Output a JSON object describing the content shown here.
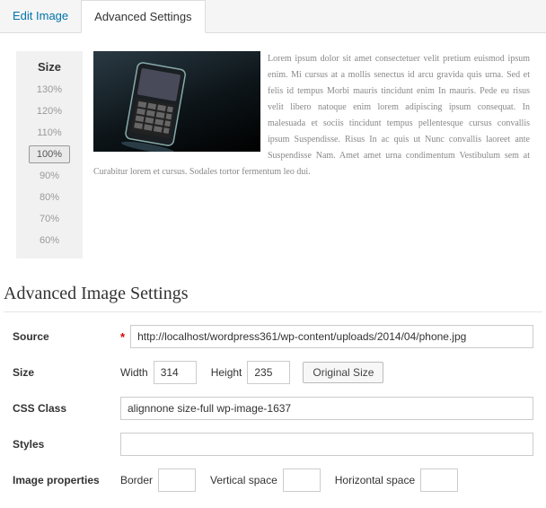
{
  "tabs": {
    "edit": "Edit Image",
    "advanced": "Advanced Settings"
  },
  "size_panel": {
    "title": "Size",
    "selected": "100%",
    "options": [
      "130%",
      "120%",
      "110%",
      "100%",
      "90%",
      "80%",
      "70%",
      "60%"
    ]
  },
  "lorem": "Lorem ipsum dolor sit amet consectetuer velit pretium euismod ipsum enim. Mi cursus at a mollis senectus id arcu gravida quis urna. Sed et felis id tempus Morbi mauris tincidunt enim In mauris. Pede eu risus velit libero natoque enim lorem adipiscing ipsum consequat. In malesuada et sociis tincidunt tempus pellentesque cursus convallis ipsum Suspendisse. Risus In ac quis ut Nunc convallis laoreet ante Suspendisse Nam. Amet amet urna condimentum Vestibulum sem at Curabitur lorem et cursus. Sodales tortor fermentum leo dui.",
  "section_title": "Advanced Image Settings",
  "form": {
    "source": {
      "label": "Source",
      "value": "http://localhost/wordpress361/wp-content/uploads/2014/04/phone.jpg"
    },
    "size": {
      "label": "Size",
      "width_label": "Width",
      "width": "314",
      "height_label": "Height",
      "height": "235",
      "original_btn": "Original Size"
    },
    "css_class": {
      "label": "CSS Class",
      "value": "alignnone size-full wp-image-1637"
    },
    "styles": {
      "label": "Styles",
      "value": ""
    },
    "props": {
      "label": "Image properties",
      "border_label": "Border",
      "border": "",
      "vspace_label": "Vertical space",
      "vspace": "",
      "hspace_label": "Horizontal space",
      "hspace": ""
    }
  }
}
